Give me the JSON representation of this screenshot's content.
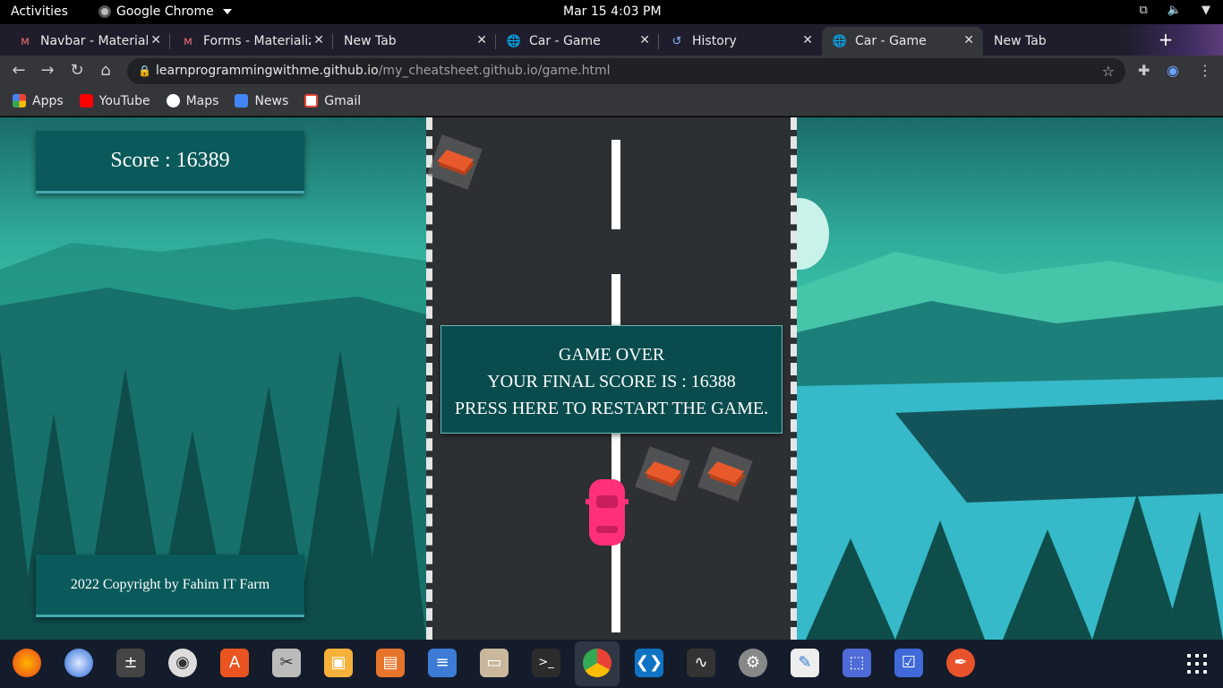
{
  "topbar": {
    "activities": "Activities",
    "app_name": "Google Chrome",
    "datetime": "Mar 15  4:03 PM"
  },
  "tabs": [
    {
      "label": "Navbar - Materializ",
      "icon": "materialize-icon",
      "active": false
    },
    {
      "label": "Forms - Materializ",
      "icon": "materialize-icon",
      "active": false
    },
    {
      "label": "New Tab",
      "icon": "",
      "active": false
    },
    {
      "label": "Car - Game",
      "icon": "globe-icon",
      "active": false
    },
    {
      "label": "History",
      "icon": "history-icon",
      "active": false
    },
    {
      "label": "Car - Game",
      "icon": "globe-icon",
      "active": true
    },
    {
      "label": "New Tab",
      "icon": "",
      "active": false
    }
  ],
  "toolbar": {
    "url_host": "learnprogrammingwithme.github.io",
    "url_path": "/my_cheatsheet.github.io/game.html"
  },
  "bookmarks": [
    {
      "label": "Apps",
      "icon": "apps-grid-icon",
      "color": "#e8453c"
    },
    {
      "label": "YouTube",
      "icon": "youtube-icon",
      "color": "#ff0000"
    },
    {
      "label": "Maps",
      "icon": "globe-icon",
      "color": "#ffffff"
    },
    {
      "label": "News",
      "icon": "news-icon",
      "color": "#4285f4"
    },
    {
      "label": "Gmail",
      "icon": "gmail-icon",
      "color": "#ea4335"
    }
  ],
  "game": {
    "score_text": "Score : 16389",
    "copyright": "2022 Copyright by Fahim IT Farm",
    "gameover_line1": "GAME OVER",
    "gameover_line2": "YOUR FINAL SCORE IS : 16388",
    "gameover_line3": "PRESS HERE TO RESTART THE GAME."
  },
  "dock": [
    "firefox-icon",
    "thunderbird-icon",
    "calculator-icon",
    "rhythmbox-icon",
    "app-store-icon",
    "video-editor-icon",
    "image-viewer-icon",
    "presentation-icon",
    "writer-icon",
    "files-icon",
    "terminal-icon",
    "chrome-icon",
    "vscode-icon",
    "system-monitor-icon",
    "settings-icon",
    "text-editor-icon",
    "screenshot-icon",
    "tasks-icon",
    "inkscape-icon"
  ],
  "colors": {
    "score_box": "#0b5a5b",
    "road": "#2d3033",
    "player_car": "#ff2f7a",
    "enemy_car": "#e85a2c"
  }
}
